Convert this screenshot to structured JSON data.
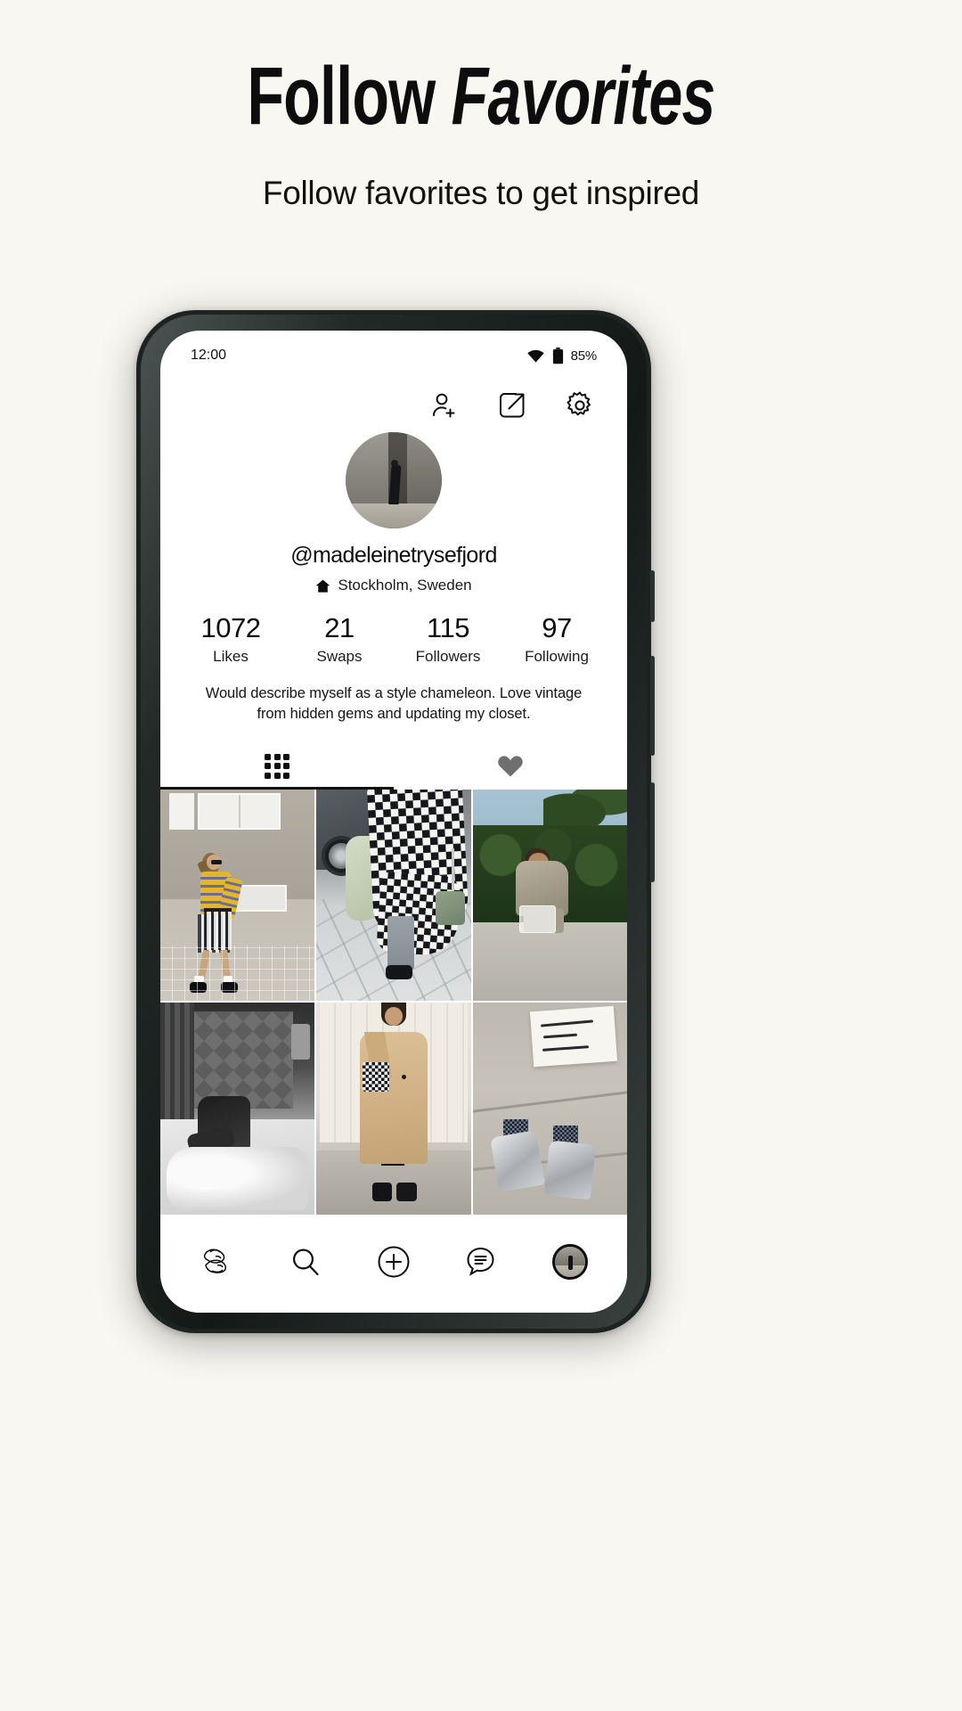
{
  "promo": {
    "title_plain": "Follow ",
    "title_emphasis": "Favorites",
    "subtitle": "Follow favorites to get inspired"
  },
  "phone": {
    "status_bar": {
      "time": "12:00",
      "wifi_icon": "wifi-icon",
      "battery_icon": "battery-icon",
      "battery_percent": "85%"
    },
    "top_actions": [
      {
        "name": "add-friend-icon",
        "label": "Add friend"
      },
      {
        "name": "share-icon",
        "label": "Share profile"
      },
      {
        "name": "settings-gear-icon",
        "label": "Settings"
      }
    ],
    "profile": {
      "avatar_alt": "profile photo",
      "handle": "@madeleinetrysefjord",
      "location_icon": "home-icon",
      "location": "Stockholm, Sweden",
      "bio": "Would describe myself as a style chameleon. Love vintage from hidden gems and updating my closet.",
      "stats": [
        {
          "value": "1072",
          "label": "Likes"
        },
        {
          "value": "21",
          "label": "Swaps"
        },
        {
          "value": "115",
          "label": "Followers"
        },
        {
          "value": "97",
          "label": "Following"
        }
      ]
    },
    "tabs": [
      {
        "name": "tab-grid",
        "icon": "grid-icon",
        "active": true
      },
      {
        "name": "tab-likes",
        "icon": "heart-icon",
        "active": false
      }
    ],
    "photo_grid": [
      {
        "alt": "Yellow and purple striped sweater with checked skirt on a city street"
      },
      {
        "alt": "Black and white checkerboard knit dress with green bag"
      },
      {
        "alt": "Person crouching by a green hedge holding a clear bag"
      },
      {
        "alt": "Black and white bedroom photo lying on bed"
      },
      {
        "alt": "Beige trench coat with black dress and checkered handbag"
      },
      {
        "alt": "Silver metallic boots on pavement next to a handwritten sign"
      }
    ],
    "bottom_nav": [
      {
        "name": "nav-home-logo",
        "icon": "popswap-logo-icon",
        "label": "POP SWAP",
        "active": false
      },
      {
        "name": "nav-search",
        "icon": "search-icon",
        "label": "Search",
        "active": false
      },
      {
        "name": "nav-add",
        "icon": "plus-circle-icon",
        "label": "Add",
        "active": false
      },
      {
        "name": "nav-messages",
        "icon": "chat-bubble-icon",
        "label": "Messages",
        "active": false
      },
      {
        "name": "nav-profile",
        "icon": "avatar-icon",
        "label": "Profile",
        "active": true
      }
    ]
  },
  "colors": {
    "page_background": "#f8f7f2",
    "ink": "#0d0d0d",
    "phone_frame": "#1d2321",
    "screen": "#ffffff"
  }
}
